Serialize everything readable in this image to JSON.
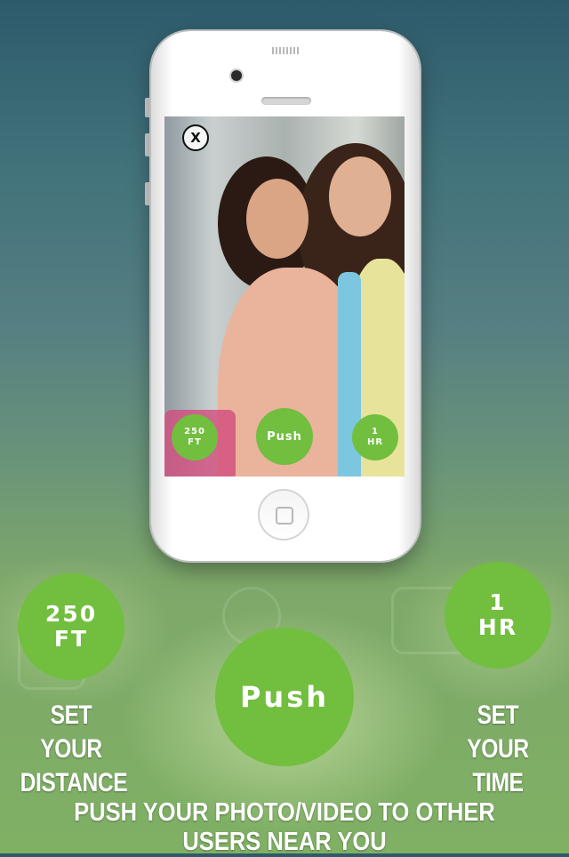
{
  "screen_preview": {
    "close_label": "X",
    "distance_line1": "250",
    "distance_line2": "FT",
    "push_label": "Push",
    "time_line1": "1",
    "time_line2": "HR"
  },
  "controls": {
    "distance_line1": "250",
    "distance_line2": "FT",
    "push_label": "Push",
    "time_line1": "1",
    "time_line2": "HR"
  },
  "captions": {
    "distance_line1": "SET YOUR",
    "distance_line2": "DISTANCE",
    "time_line1": "SET YOUR",
    "time_line2": "TIME"
  },
  "footer": "PUSH YOUR PHOTO/VIDEO TO OTHER USERS NEAR YOU",
  "colors": {
    "accent_green": "#72be3f",
    "background_top": "#2e5a6b",
    "background_bottom": "#7fb064"
  }
}
